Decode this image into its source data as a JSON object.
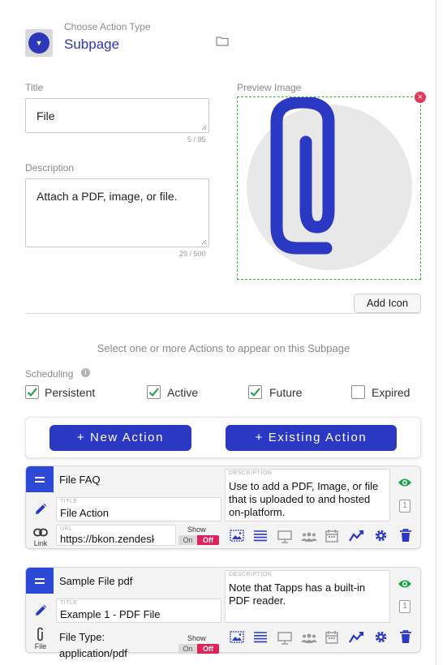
{
  "header": {
    "choose_label": "Choose Action Type",
    "choose_value": "Subpage",
    "type_icon": "chevron-down-icon",
    "folder_icon": "folder-icon"
  },
  "form": {
    "title_label": "Title",
    "title_value": "File",
    "title_count": "5 / 85",
    "description_label": "Description",
    "description_value": "Attach a PDF, image, or file.",
    "description_count": "29 / 500",
    "preview_label": "Preview Image",
    "preview_icon": "paperclip-icon",
    "add_icon_label": "Add Icon"
  },
  "select_text": "Select one or more Actions to appear on this Subpage",
  "scheduling": {
    "label": "Scheduling",
    "options": [
      {
        "label": "Persistent",
        "checked": true
      },
      {
        "label": "Active",
        "checked": true
      },
      {
        "label": "Future",
        "checked": true
      },
      {
        "label": "Expired",
        "checked": false
      }
    ]
  },
  "buttons": {
    "new_action": "+ New Action",
    "existing_action": "+ Existing Action"
  },
  "actions": [
    {
      "name": "File FAQ",
      "title_caption": "TITLE",
      "title": "File Action",
      "description_caption": "DESCRIPTION",
      "description": "Use to add a PDF, Image, or file that is uploaded to and hosted on-platform.",
      "link_caption": "Link",
      "url_caption": "URL",
      "url": "https://bkon.zendesk.com",
      "show_label": "Show",
      "toggle_on": "On",
      "toggle_off": "Off",
      "visibility_count": "1"
    },
    {
      "name": "Sample File pdf",
      "title_caption": "TITLE",
      "title": "Example 1 - PDF File",
      "description_caption": "DESCRIPTION",
      "description": "Note that Tapps has a built-in PDF reader.",
      "file_caption": "File",
      "file_type": "File Type: application/pdf",
      "show_label": "Show",
      "toggle_on": "On",
      "toggle_off": "Off",
      "visibility_count": "1"
    }
  ],
  "colors": {
    "accent": "#2b38c4",
    "toggle_off": "#e0235a",
    "eye_green": "#1aa34a",
    "preview_border": "#2fb62f"
  }
}
